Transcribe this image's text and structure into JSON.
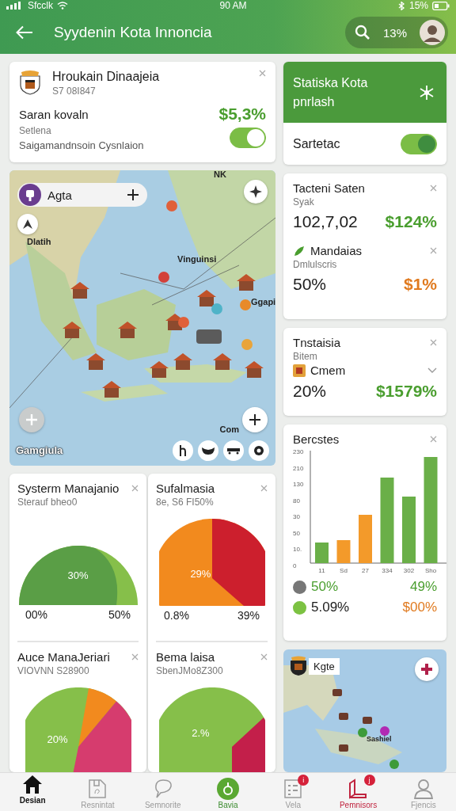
{
  "status_bar": {
    "carrier": "Sfcclk",
    "time": "90 AM",
    "battery": "15%"
  },
  "header": {
    "title": "Syydenin Kota Innoncia",
    "search_value": "13%"
  },
  "profile_card": {
    "title": "Hroukain Dinaajeia",
    "subtitle": "S7 08I847",
    "label": "Saran kovaln",
    "value": "$5,3%",
    "caption": "Setlena",
    "description": "Saigamandnsoin Cysnlaion",
    "toggle_on": true
  },
  "stat_card": {
    "title": "Statiska Kota pnrlash",
    "toggle_label": "Sartetac",
    "toggle_on": true
  },
  "map": {
    "search_label": "Agta",
    "top_label": "NK",
    "caption": "Gamgiula",
    "corner_label": "Com",
    "places": [
      "Dlatih",
      "Vinguinsi",
      "Ggapi"
    ]
  },
  "metrics": [
    {
      "title": "Tacteni Saten",
      "subtitle": "Syak",
      "value": "102,7,02",
      "delta": "$124%",
      "color": "#4a9e2f"
    },
    {
      "title": "Mandaias",
      "subtitle": "Dmlulscris",
      "value": "50%",
      "delta": "$1%",
      "color": "#e07a1f"
    }
  ],
  "select_card": {
    "title": "Tnstaisia",
    "subtitle": "Bitem",
    "option": "Cmem",
    "value": "20%",
    "delta": "$1579%"
  },
  "bar_card": {
    "title": "Bercstes",
    "y_tick_labels": [
      "230",
      "210",
      "130",
      "80",
      "30",
      "50",
      "10.",
      "0"
    ],
    "x_labels": [
      "11",
      "Sd",
      "27",
      "334",
      "302",
      "Sho"
    ],
    "legend": [
      {
        "color": "#777777",
        "label": "50%",
        "value": "49%"
      },
      {
        "color": "#7cc242",
        "label": "5.09%",
        "value": "$00%"
      }
    ]
  },
  "pie_cards": [
    {
      "title": "Systerm Manajanio",
      "subtitle": "Sterauf bheo0",
      "center_label": "30%",
      "left_label": "00%",
      "right_label": "50%"
    },
    {
      "title": "Sufalmasia",
      "subtitle": "8e, S6 FI50%",
      "center_label": "29%",
      "left_label": "0.8%",
      "right_label": "39%"
    },
    {
      "title": "Auce ManaJeriari",
      "subtitle": "VIOVNN S28900",
      "center_label": "20%"
    },
    {
      "title": "Bema laisa",
      "subtitle": "SbenJMo8Z300",
      "center_label": "2.%"
    }
  ],
  "mini_map": {
    "label": "Kgte",
    "place": "Sashiel"
  },
  "nav": [
    {
      "label": "Desian",
      "selected": true
    },
    {
      "label": "Resnintat",
      "selected": false
    },
    {
      "label": "Semnorite",
      "selected": false
    },
    {
      "label": "Bavia",
      "selected": false
    },
    {
      "label": "Vela",
      "selected": false,
      "badge": "i"
    },
    {
      "label": "Pemnisors",
      "selected": false,
      "badge": "j"
    },
    {
      "label": "Fjencis",
      "selected": false
    }
  ]
}
